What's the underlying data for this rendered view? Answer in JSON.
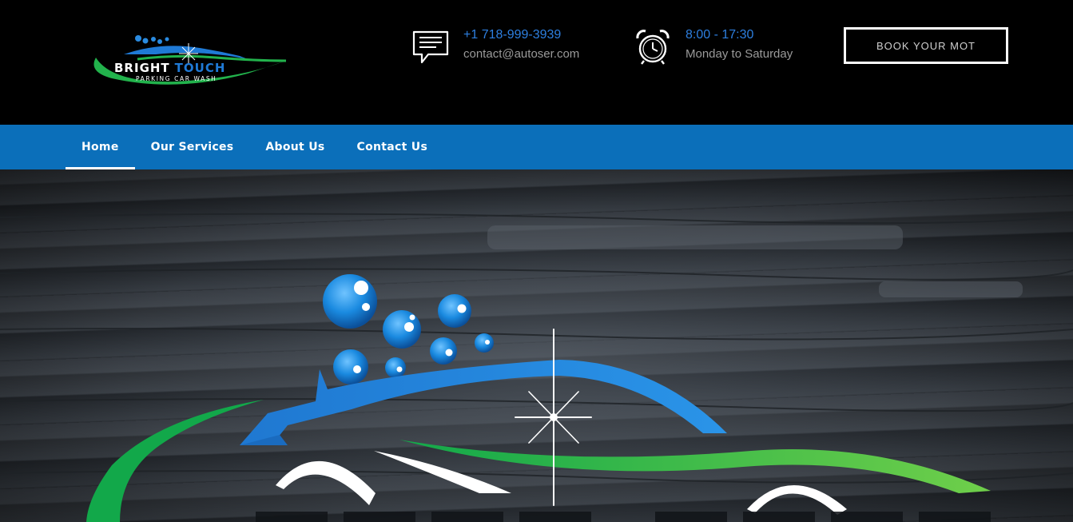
{
  "brand": {
    "name_primary": "BRIGHT",
    "name_secondary": "TOUCH",
    "tagline": "PARKING CAR WASH"
  },
  "contact": {
    "icon": "chat-icon",
    "phone": "+1 718-999-3939",
    "email": "contact@autoser.com"
  },
  "hours": {
    "icon": "alarm-clock-icon",
    "time": "8:00 - 17:30",
    "days": "Monday to Saturday"
  },
  "cta": {
    "label": "BOOK YOUR MOT"
  },
  "nav": {
    "items": [
      {
        "label": "Home",
        "active": true
      },
      {
        "label": "Our Services",
        "active": false
      },
      {
        "label": "About Us",
        "active": false
      },
      {
        "label": "Contact Us",
        "active": false
      }
    ]
  },
  "colors": {
    "nav_bg": "#0b6fba",
    "accent_blue": "#2d7fe0",
    "logo_green": "#22b24c"
  }
}
